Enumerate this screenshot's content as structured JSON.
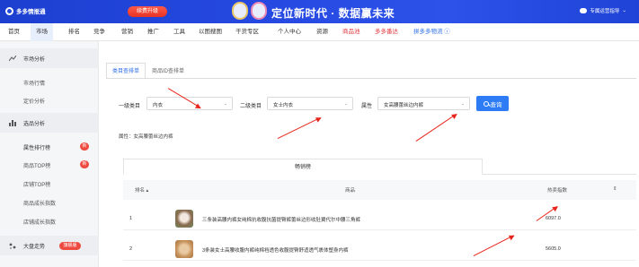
{
  "banner": {
    "logo_text": "多多情报通",
    "upgrade_label": "续费升级",
    "slogan": "定位新时代 · 数据赢未来",
    "wechat_label": "专属运营指导"
  },
  "nav": {
    "items": [
      {
        "label": "首页"
      },
      {
        "label": "市场"
      },
      {
        "label": "排名"
      },
      {
        "label": "竞争"
      },
      {
        "label": "营销"
      },
      {
        "label": "推广"
      },
      {
        "label": "工具"
      },
      {
        "label": "以图搜图"
      },
      {
        "label": "干货专区"
      },
      {
        "label": "个人中心"
      },
      {
        "label": "资源"
      },
      {
        "label": "商品池"
      },
      {
        "label": "多多番达"
      },
      {
        "label": "拼多多物流 ⓘ"
      }
    ]
  },
  "sidebar": {
    "group1": "市场分析",
    "group1_items": [
      "市场行情",
      "定价分析"
    ],
    "group2": "选品分析",
    "group2_items": [
      "属性排行榜",
      "商品TOP榜",
      "店铺TOP榜",
      "商品成长指数",
      "店铺成长指数"
    ],
    "badge_new": "新",
    "group3": "大盘走势",
    "group3_badge": "旗舰版"
  },
  "main": {
    "tabs": [
      "类目查排单",
      "商品ID查排单"
    ],
    "filters": {
      "cat1_label": "一级类目",
      "cat1_value": "内衣",
      "cat2_label": "二级类目",
      "cat2_value": "女士内衣",
      "attr_label": "属性",
      "attr_value": "女高腰蕾丝边内裤",
      "query_label": "查询"
    },
    "attr_line": "属性：女高腰蕾丝边内裤",
    "table": {
      "tab_label": "畅销榜",
      "headers": {
        "rank": "排名",
        "product": "商品",
        "hot": "热卖指数"
      },
      "rows": [
        {
          "rank": "1",
          "name": "三条装高腰内裤女纯棉抗收腹抗菌提臀裤蕾丝边形收肚翼代尔中腰三角裤",
          "hot": "6097.0"
        },
        {
          "rank": "2",
          "name": "3条装女士高腰收腹内裤纯棉裆透色收腹提臀舒适透气裹体塑身内裤",
          "hot": "5605.0"
        }
      ]
    }
  },
  "colors": {
    "banner": "#2548e0",
    "accent": "#2f6fe8",
    "badge": "#ef4a3f",
    "arrow": "#e8251c"
  }
}
